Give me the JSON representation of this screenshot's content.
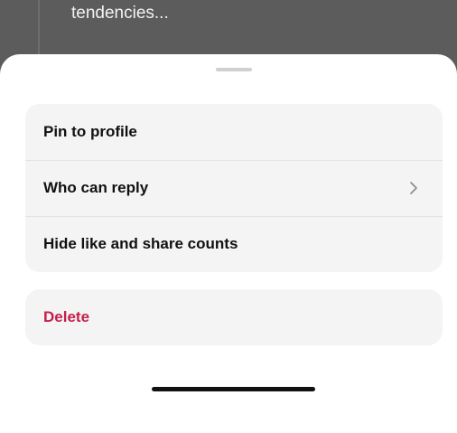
{
  "background_post": {
    "text": "tendencies..."
  },
  "menu": {
    "items": [
      {
        "label": "Pin to profile"
      },
      {
        "label": "Who can reply",
        "chevron": "chevron-right-icon"
      },
      {
        "label": "Hide like and share counts"
      }
    ],
    "danger_items": [
      {
        "label": "Delete",
        "color": "#c3204c"
      }
    ]
  }
}
